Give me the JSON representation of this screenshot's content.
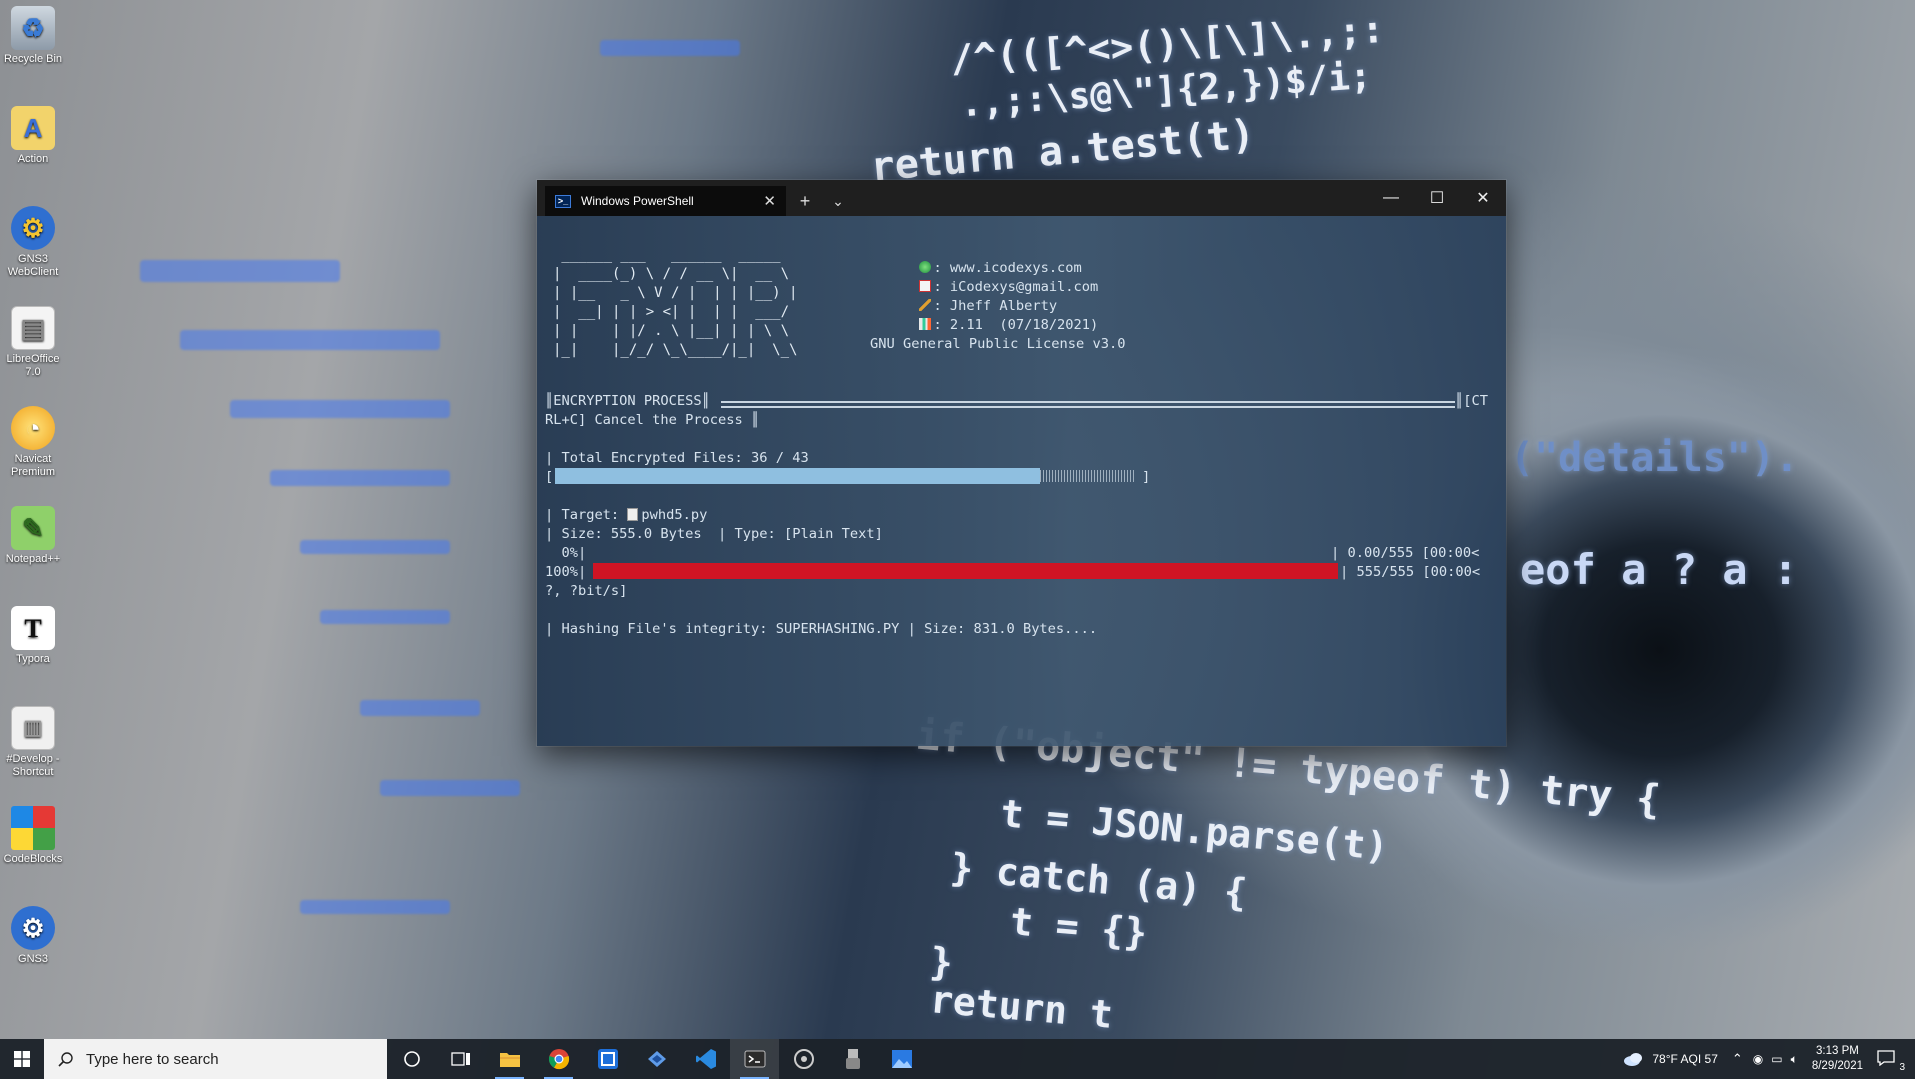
{
  "desktop_icons": [
    {
      "label": "Recycle Bin",
      "icon": "recycle-bin-icon"
    },
    {
      "label": "Action",
      "icon": "action-icon"
    },
    {
      "label": "GNS3 WebClient",
      "icon": "gns3-webclient-icon"
    },
    {
      "label": "LibreOffice 7.0",
      "icon": "libreoffice-icon"
    },
    {
      "label": "Navicat Premium",
      "icon": "navicat-icon"
    },
    {
      "label": "Notepad++",
      "icon": "notepadpp-icon"
    },
    {
      "label": "Typora",
      "icon": "typora-icon"
    },
    {
      "label": "#Develop - Shortcut",
      "icon": "develop-shortcut-icon"
    },
    {
      "label": "CodeBlocks",
      "icon": "codeblocks-icon"
    },
    {
      "label": "GNS3",
      "icon": "gns3-icon"
    }
  ],
  "wallpaper_code": {
    "l1": "/^(([^<>()\\[\\]\\.,;:",
    "l2": ".,;:\\s@\\\"]{2,})$/i;",
    "l3": "return a.test(t)",
    "l4": "if (\"object\" != typeof t) try {",
    "l5": "t = JSON.parse(t)",
    "l6": "} catch (a) {",
    "l7": "t = {}",
    "l8": "}",
    "l9": "return t",
    "l10": "(\"details\").",
    "l11": "eof a ? a :"
  },
  "window": {
    "tab_title": "Windows PowerShell",
    "new_tab": "+",
    "dropdown": "⌄",
    "minimize": "—",
    "maximize": "☐",
    "close": "✕"
  },
  "terminal": {
    "ascii_art": " ______ ___   ______  _____\n|  ____(_) \\ / / __ \\|  __ \\\n| |__   _ \\ V / |  | | |__) |\n|  __| | | > <| |  | |  ___/\n| |    | |/ . \\ |__| | | \\ \\\n|_|    |_/_/ \\_\\____/|_|  \\_\\",
    "website": ": www.icodexys.com",
    "email": ": iCodexys@gmail.com",
    "author": ": Jheff Alberty",
    "version": ": 2.11  (07/18/2021)",
    "license": "GNU General Public License v3.0",
    "enc_process_label": "║ENCRYPTION PROCESS║",
    "enc_process_right": "║[CT",
    "enc_process_line2": "RL+C] Cancel the Process ║",
    "total_files": "| Total Encrypted Files: 36 / 43",
    "total_bar_open": "[",
    "total_bar_close": "]",
    "target_prefix": "| Target: ",
    "target_file": "pwhd5.py",
    "size_line": "| Size: 555.0 Bytes  | Type: [Plain Text]",
    "p0_pct": "  0%|",
    "p0_right": "| 0.00/555 [00:00<",
    "p100_pct": "100%|",
    "p100_right": "| 555/555 [00:00<",
    "rate_line": "?, ?bit/s]",
    "hashing_line": "| Hashing File's integrity: SUPERHASHING.PY | Size: 831.0 Bytes...."
  },
  "progress": {
    "encrypted_count": 36,
    "encrypted_total": 43,
    "file_progress": 1.0
  },
  "colors": {
    "progress_fill": "#8fbfe0",
    "file_bar": "#d01424",
    "accent": "#3d7bd9"
  },
  "taskbar": {
    "search_placeholder": "Type here to search",
    "apps": [
      {
        "name": "cortana",
        "icon": "cortana-icon"
      },
      {
        "name": "task-view",
        "icon": "task-view-icon"
      },
      {
        "name": "file-explorer",
        "icon": "folder-icon"
      },
      {
        "name": "chrome",
        "icon": "chrome-icon"
      },
      {
        "name": "app-blue",
        "icon": "blue-app-icon"
      },
      {
        "name": "visual-studio",
        "icon": "visual-studio-icon"
      },
      {
        "name": "vscode",
        "icon": "vscode-icon"
      },
      {
        "name": "terminal",
        "icon": "terminal-icon"
      },
      {
        "name": "gns3",
        "icon": "gns3-taskbar-icon"
      },
      {
        "name": "usb-app",
        "icon": "usb-icon"
      },
      {
        "name": "photos",
        "icon": "photo-icon"
      }
    ],
    "weather": "78°F  AQI 57",
    "time": "3:13 PM",
    "date": "8/29/2021",
    "notifications": "3"
  }
}
